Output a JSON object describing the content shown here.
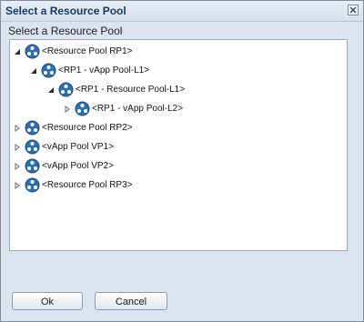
{
  "dialog": {
    "title": "Select a Resource Pool",
    "close_icon": "close-icon"
  },
  "content": {
    "section_label": "Select a Resource Pool"
  },
  "tree": {
    "nodes": [
      {
        "label": "<Resource Pool RP1>",
        "expanded": true,
        "level": 0,
        "icon": "resource-pool-icon"
      },
      {
        "label": "<RP1 - vApp Pool-L1>",
        "expanded": true,
        "level": 1,
        "icon": "resource-pool-icon"
      },
      {
        "label": "<RP1 - Resource Pool-L1>",
        "expanded": true,
        "level": 2,
        "icon": "resource-pool-icon"
      },
      {
        "label": "<RP1 - vApp Pool-L2>",
        "expanded": false,
        "level": 3,
        "icon": "resource-pool-icon"
      },
      {
        "label": "<Resource Pool RP2>",
        "expanded": false,
        "level": 0,
        "icon": "resource-pool-icon"
      },
      {
        "label": "<vApp Pool VP1>",
        "expanded": false,
        "level": 0,
        "icon": "resource-pool-icon"
      },
      {
        "label": "<vApp Pool VP2>",
        "expanded": false,
        "level": 0,
        "icon": "resource-pool-icon"
      },
      {
        "label": "<Resource Pool RP3>",
        "expanded": false,
        "level": 0,
        "icon": "resource-pool-icon"
      }
    ]
  },
  "buttons": {
    "ok_label": "Ok",
    "cancel_label": "Cancel"
  },
  "colors": {
    "title_text": "#173a64",
    "dialog_bg": "#dbe3ee",
    "icon_blue": "#2e6fb0"
  }
}
